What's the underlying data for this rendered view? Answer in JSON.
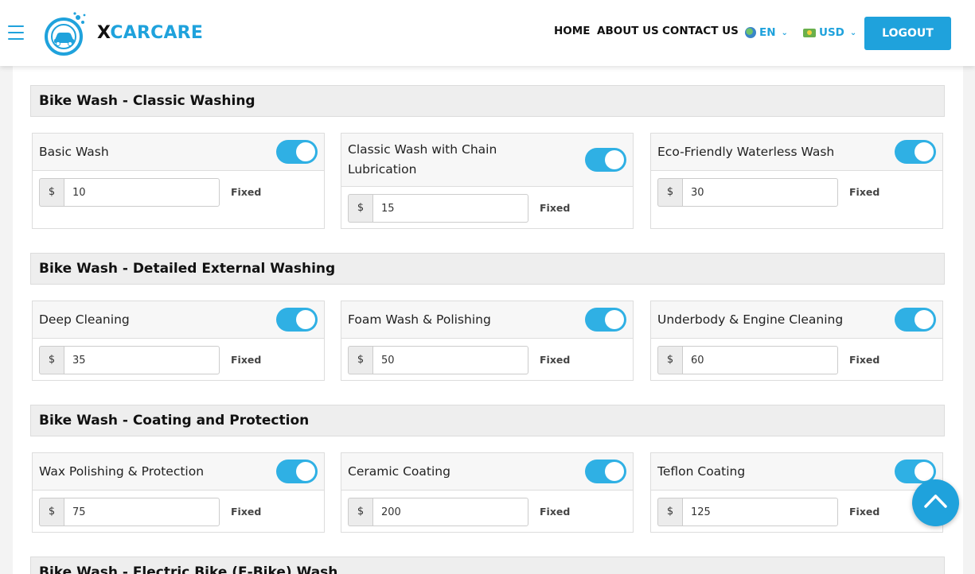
{
  "header": {
    "brand_x": "X",
    "brand_rest": "CARCARE",
    "nav": [
      "HOME",
      "ABOUT US",
      "CONTACT US"
    ],
    "language": "EN",
    "currency": "USD",
    "logout_label": "LOGOUT"
  },
  "sections": [
    {
      "title": "Bike Wash - Classic Washing",
      "services": [
        {
          "name": "Basic Wash",
          "currency_symbol": "$",
          "price": "10",
          "type": "Fixed",
          "enabled": true
        },
        {
          "name": "Classic Wash with Chain Lubrication",
          "currency_symbol": "$",
          "price": "15",
          "type": "Fixed",
          "enabled": true
        },
        {
          "name": "Eco-Friendly Waterless Wash",
          "currency_symbol": "$",
          "price": "30",
          "type": "Fixed",
          "enabled": true
        }
      ]
    },
    {
      "title": "Bike Wash - Detailed External Washing",
      "services": [
        {
          "name": "Deep Cleaning",
          "currency_symbol": "$",
          "price": "35",
          "type": "Fixed",
          "enabled": true
        },
        {
          "name": "Foam Wash & Polishing",
          "currency_symbol": "$",
          "price": "50",
          "type": "Fixed",
          "enabled": true
        },
        {
          "name": "Underbody & Engine Cleaning",
          "currency_symbol": "$",
          "price": "60",
          "type": "Fixed",
          "enabled": true
        }
      ]
    },
    {
      "title": "Bike Wash - Coating and Protection",
      "services": [
        {
          "name": "Wax Polishing & Protection",
          "currency_symbol": "$",
          "price": "75",
          "type": "Fixed",
          "enabled": true
        },
        {
          "name": "Ceramic Coating",
          "currency_symbol": "$",
          "price": "200",
          "type": "Fixed",
          "enabled": true
        },
        {
          "name": "Teflon Coating",
          "currency_symbol": "$",
          "price": "125",
          "type": "Fixed",
          "enabled": true
        }
      ]
    },
    {
      "title": "Bike Wash - Electric Bike (E-Bike) Wash",
      "services": []
    }
  ],
  "colors": {
    "accent": "#1fa2dc",
    "toggle_on": "#2fb0e4"
  }
}
